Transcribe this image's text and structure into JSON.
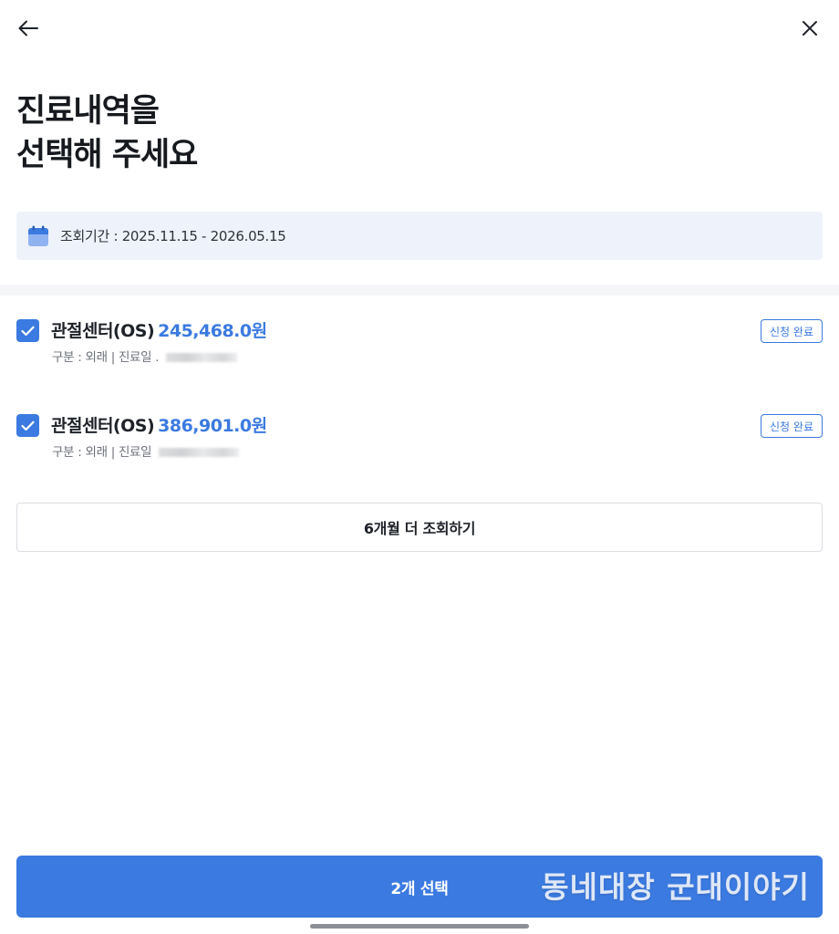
{
  "header": {
    "back_icon": "arrow-left-icon",
    "close_icon": "close-icon"
  },
  "title": {
    "line1": "진료내역을",
    "line2": "선택해 주세요"
  },
  "period": {
    "icon": "calendar-icon",
    "text": "조회기간 : 2025.11.15 - 2026.05.15"
  },
  "records": [
    {
      "checked": true,
      "name": "관절센터(OS)",
      "amount": "245,468.0원",
      "sub_prefix": "구분 : 외래 | 진료일 .",
      "status": "신청 완료"
    },
    {
      "checked": true,
      "name": "관절센터(OS)",
      "amount": "386,901.0원",
      "sub_prefix": "구분 : 외래 | 진료일",
      "status": "신청 완료"
    }
  ],
  "more_button": {
    "label": "6개월 더 조회하기"
  },
  "select_button": {
    "label": "2개 선택"
  },
  "watermark": {
    "text": "동네대장 군대이야기"
  },
  "colors": {
    "accent": "#3b7ae0",
    "period_bg": "#eef3fb",
    "text": "#1f2329"
  }
}
